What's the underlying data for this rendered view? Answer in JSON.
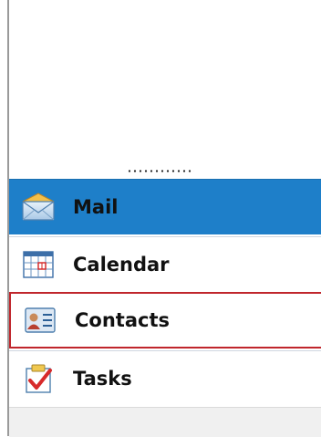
{
  "nav": {
    "items": [
      {
        "label": "Mail",
        "icon": "mail-icon",
        "selected": true
      },
      {
        "label": "Calendar",
        "icon": "calendar-icon"
      },
      {
        "label": "Contacts",
        "icon": "contacts-icon",
        "highlighted": true
      },
      {
        "label": "Tasks",
        "icon": "tasks-icon"
      }
    ]
  },
  "colors": {
    "selected_bg": "#1e7fc9",
    "highlight_border": "#c0262c"
  }
}
